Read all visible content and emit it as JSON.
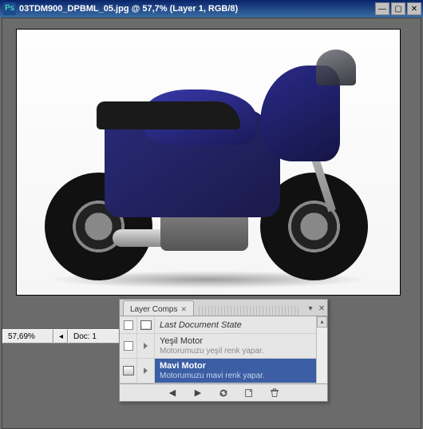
{
  "titlebar": {
    "app_icon": "Ps",
    "title": "03TDM900_DPBML_05.jpg @ 57,7% (Layer 1, RGB/8)"
  },
  "status": {
    "zoom": "57,69%",
    "doc": "Doc: 1"
  },
  "panel": {
    "tab_label": "Layer Comps",
    "last_state": "Last Document State",
    "comps": [
      {
        "name": "Yeşil Motor",
        "desc": "Motorumuzu yeşil renk yapar.",
        "selected": false
      },
      {
        "name": "Mavi Motor",
        "desc": "Motorumuzu mavi renk yapar.",
        "selected": true
      }
    ]
  }
}
